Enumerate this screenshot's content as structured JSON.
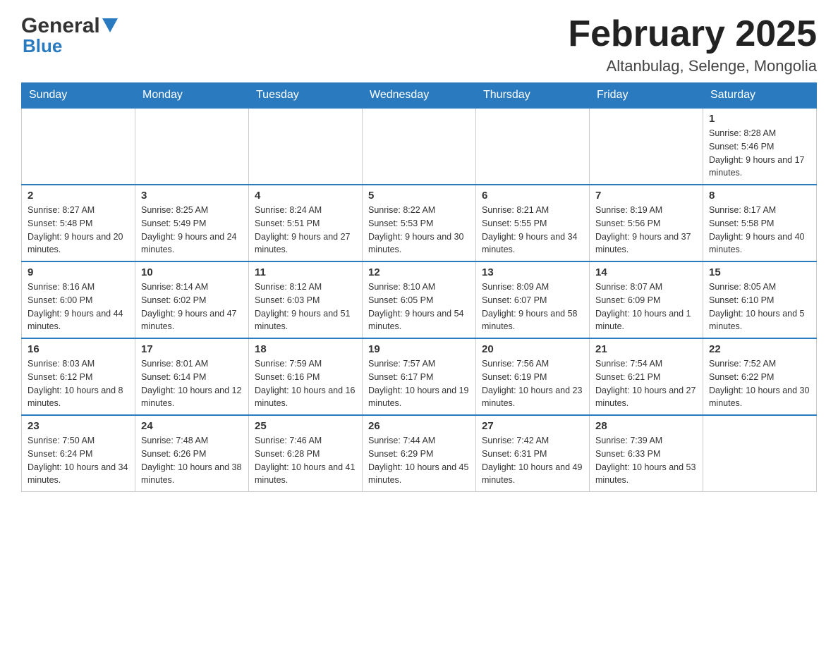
{
  "header": {
    "logo_general": "General",
    "logo_blue": "Blue",
    "month_title": "February 2025",
    "location": "Altanbulag, Selenge, Mongolia"
  },
  "weekdays": [
    "Sunday",
    "Monday",
    "Tuesday",
    "Wednesday",
    "Thursday",
    "Friday",
    "Saturday"
  ],
  "weeks": [
    [
      {
        "day": "",
        "info": ""
      },
      {
        "day": "",
        "info": ""
      },
      {
        "day": "",
        "info": ""
      },
      {
        "day": "",
        "info": ""
      },
      {
        "day": "",
        "info": ""
      },
      {
        "day": "",
        "info": ""
      },
      {
        "day": "1",
        "info": "Sunrise: 8:28 AM\nSunset: 5:46 PM\nDaylight: 9 hours and 17 minutes."
      }
    ],
    [
      {
        "day": "2",
        "info": "Sunrise: 8:27 AM\nSunset: 5:48 PM\nDaylight: 9 hours and 20 minutes."
      },
      {
        "day": "3",
        "info": "Sunrise: 8:25 AM\nSunset: 5:49 PM\nDaylight: 9 hours and 24 minutes."
      },
      {
        "day": "4",
        "info": "Sunrise: 8:24 AM\nSunset: 5:51 PM\nDaylight: 9 hours and 27 minutes."
      },
      {
        "day": "5",
        "info": "Sunrise: 8:22 AM\nSunset: 5:53 PM\nDaylight: 9 hours and 30 minutes."
      },
      {
        "day": "6",
        "info": "Sunrise: 8:21 AM\nSunset: 5:55 PM\nDaylight: 9 hours and 34 minutes."
      },
      {
        "day": "7",
        "info": "Sunrise: 8:19 AM\nSunset: 5:56 PM\nDaylight: 9 hours and 37 minutes."
      },
      {
        "day": "8",
        "info": "Sunrise: 8:17 AM\nSunset: 5:58 PM\nDaylight: 9 hours and 40 minutes."
      }
    ],
    [
      {
        "day": "9",
        "info": "Sunrise: 8:16 AM\nSunset: 6:00 PM\nDaylight: 9 hours and 44 minutes."
      },
      {
        "day": "10",
        "info": "Sunrise: 8:14 AM\nSunset: 6:02 PM\nDaylight: 9 hours and 47 minutes."
      },
      {
        "day": "11",
        "info": "Sunrise: 8:12 AM\nSunset: 6:03 PM\nDaylight: 9 hours and 51 minutes."
      },
      {
        "day": "12",
        "info": "Sunrise: 8:10 AM\nSunset: 6:05 PM\nDaylight: 9 hours and 54 minutes."
      },
      {
        "day": "13",
        "info": "Sunrise: 8:09 AM\nSunset: 6:07 PM\nDaylight: 9 hours and 58 minutes."
      },
      {
        "day": "14",
        "info": "Sunrise: 8:07 AM\nSunset: 6:09 PM\nDaylight: 10 hours and 1 minute."
      },
      {
        "day": "15",
        "info": "Sunrise: 8:05 AM\nSunset: 6:10 PM\nDaylight: 10 hours and 5 minutes."
      }
    ],
    [
      {
        "day": "16",
        "info": "Sunrise: 8:03 AM\nSunset: 6:12 PM\nDaylight: 10 hours and 8 minutes."
      },
      {
        "day": "17",
        "info": "Sunrise: 8:01 AM\nSunset: 6:14 PM\nDaylight: 10 hours and 12 minutes."
      },
      {
        "day": "18",
        "info": "Sunrise: 7:59 AM\nSunset: 6:16 PM\nDaylight: 10 hours and 16 minutes."
      },
      {
        "day": "19",
        "info": "Sunrise: 7:57 AM\nSunset: 6:17 PM\nDaylight: 10 hours and 19 minutes."
      },
      {
        "day": "20",
        "info": "Sunrise: 7:56 AM\nSunset: 6:19 PM\nDaylight: 10 hours and 23 minutes."
      },
      {
        "day": "21",
        "info": "Sunrise: 7:54 AM\nSunset: 6:21 PM\nDaylight: 10 hours and 27 minutes."
      },
      {
        "day": "22",
        "info": "Sunrise: 7:52 AM\nSunset: 6:22 PM\nDaylight: 10 hours and 30 minutes."
      }
    ],
    [
      {
        "day": "23",
        "info": "Sunrise: 7:50 AM\nSunset: 6:24 PM\nDaylight: 10 hours and 34 minutes."
      },
      {
        "day": "24",
        "info": "Sunrise: 7:48 AM\nSunset: 6:26 PM\nDaylight: 10 hours and 38 minutes."
      },
      {
        "day": "25",
        "info": "Sunrise: 7:46 AM\nSunset: 6:28 PM\nDaylight: 10 hours and 41 minutes."
      },
      {
        "day": "26",
        "info": "Sunrise: 7:44 AM\nSunset: 6:29 PM\nDaylight: 10 hours and 45 minutes."
      },
      {
        "day": "27",
        "info": "Sunrise: 7:42 AM\nSunset: 6:31 PM\nDaylight: 10 hours and 49 minutes."
      },
      {
        "day": "28",
        "info": "Sunrise: 7:39 AM\nSunset: 6:33 PM\nDaylight: 10 hours and 53 minutes."
      },
      {
        "day": "",
        "info": ""
      }
    ]
  ]
}
